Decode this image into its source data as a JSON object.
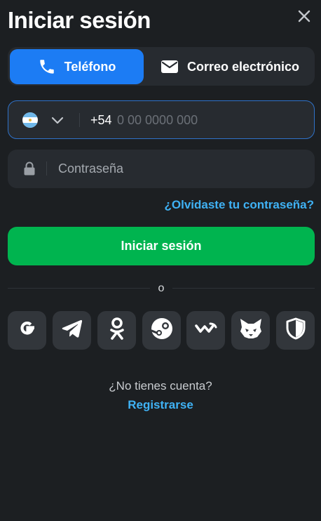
{
  "title": "Iniciar sesión",
  "close_icon": "close-icon",
  "tabs": [
    {
      "label": "Teléfono",
      "icon": "phone-icon",
      "active": true
    },
    {
      "label": "Correo electrónico",
      "icon": "mail-icon",
      "active": false
    }
  ],
  "phone": {
    "country_flag": "argentina-flag-icon",
    "prefix": "+54",
    "placeholder": "0 00 0000 000"
  },
  "password": {
    "placeholder": "Contraseña"
  },
  "forgot_label": "¿Olvidaste tu contraseña?",
  "submit_label": "Iniciar sesión",
  "separator_label": "o",
  "social": [
    "google-icon",
    "telegram-icon",
    "odnoklassniki-icon",
    "steam-icon",
    "walletconnect-icon",
    "metamask-icon",
    "shield-icon"
  ],
  "no_account_label": "¿No tienes cuenta?",
  "register_label": "Registrarse",
  "colors": {
    "background": "#1c1f22",
    "field": "#272b30",
    "accent_blue": "#1c7cf4",
    "link": "#3fb2f5",
    "submit_green": "#00b44f",
    "social_tile": "#32363b"
  }
}
